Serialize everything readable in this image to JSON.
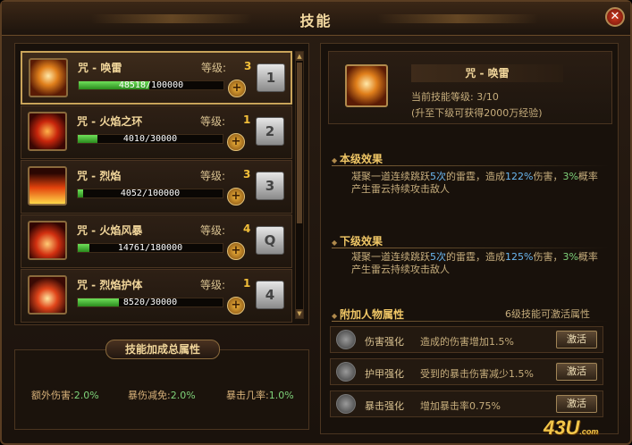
{
  "window": {
    "title": "技能"
  },
  "skills": [
    {
      "name": "咒 - 唤雷",
      "level_label": "等级:",
      "level": "3",
      "exp_text": "48518/100000",
      "progress": 0.485,
      "key": "1",
      "icon": "lightning-icon",
      "selected": true
    },
    {
      "name": "咒 - 火焰之环",
      "level_label": "等级:",
      "level": "1",
      "exp_text": "4010/30000",
      "progress": 0.134,
      "key": "2",
      "icon": "fire-ring-icon",
      "selected": false
    },
    {
      "name": "咒 - 烈焰",
      "level_label": "等级:",
      "level": "3",
      "exp_text": "4052/100000",
      "progress": 0.04,
      "key": "3",
      "icon": "flame-icon",
      "selected": false
    },
    {
      "name": "咒 - 火焰风暴",
      "level_label": "等级:",
      "level": "4",
      "exp_text": "14761/180000",
      "progress": 0.082,
      "key": "Q",
      "icon": "fire-storm-icon",
      "selected": false
    },
    {
      "name": "咒 - 烈焰护体",
      "level_label": "等级:",
      "level": "1",
      "exp_text": "8520/30000",
      "progress": 0.284,
      "key": "4",
      "icon": "flame-shield-icon",
      "selected": false
    }
  ],
  "bonus": {
    "title": "技能加成总属性",
    "items": [
      {
        "label": "额外伤害:",
        "value": "2.0%"
      },
      {
        "label": "暴伤减免:",
        "value": "2.0%"
      },
      {
        "label": "暴击几率:",
        "value": "1.0%"
      }
    ]
  },
  "detail": {
    "name": "咒 - 唤雷",
    "current_level": "当前技能等级: 3/10",
    "upgrade_hint": "(升至下级可获得2000万经验)",
    "current_effect_title": "本级效果",
    "current_effect": {
      "p1": "凝聚一道连续跳跃",
      "n1": "5次",
      "p2": "的雷霆，造成",
      "n2": "122%",
      "p3": "伤害，",
      "n3": "3%",
      "p4": "概率产生雷云持续攻击敌人"
    },
    "next_effect_title": "下级效果",
    "next_effect": {
      "p1": "凝聚一道连续跳跃",
      "n1": "5次",
      "p2": "的雷霆，造成",
      "n2": "125%",
      "p3": "伤害，",
      "n3": "3%",
      "p4": "概率产生雷云持续攻击敌人"
    },
    "attr_title": "附加人物属性",
    "attr_hint": "6级技能可激活属性",
    "attrs": [
      {
        "name": "伤害强化",
        "desc": "造成的伤害增加1.5%",
        "button": "激活"
      },
      {
        "name": "护甲强化",
        "desc": "受到的暴击伤害减少1.5%",
        "button": "激活"
      },
      {
        "name": "暴击强化",
        "desc": "增加暴击率0.75%",
        "button": "激活"
      }
    ]
  },
  "watermark": {
    "main": "43U",
    "suffix": ".com"
  },
  "colors": {
    "accent": "#f0c766",
    "progress": "#4fbf3f",
    "highlight_blue": "#6bb7f0",
    "highlight_green": "#7fd37a"
  }
}
